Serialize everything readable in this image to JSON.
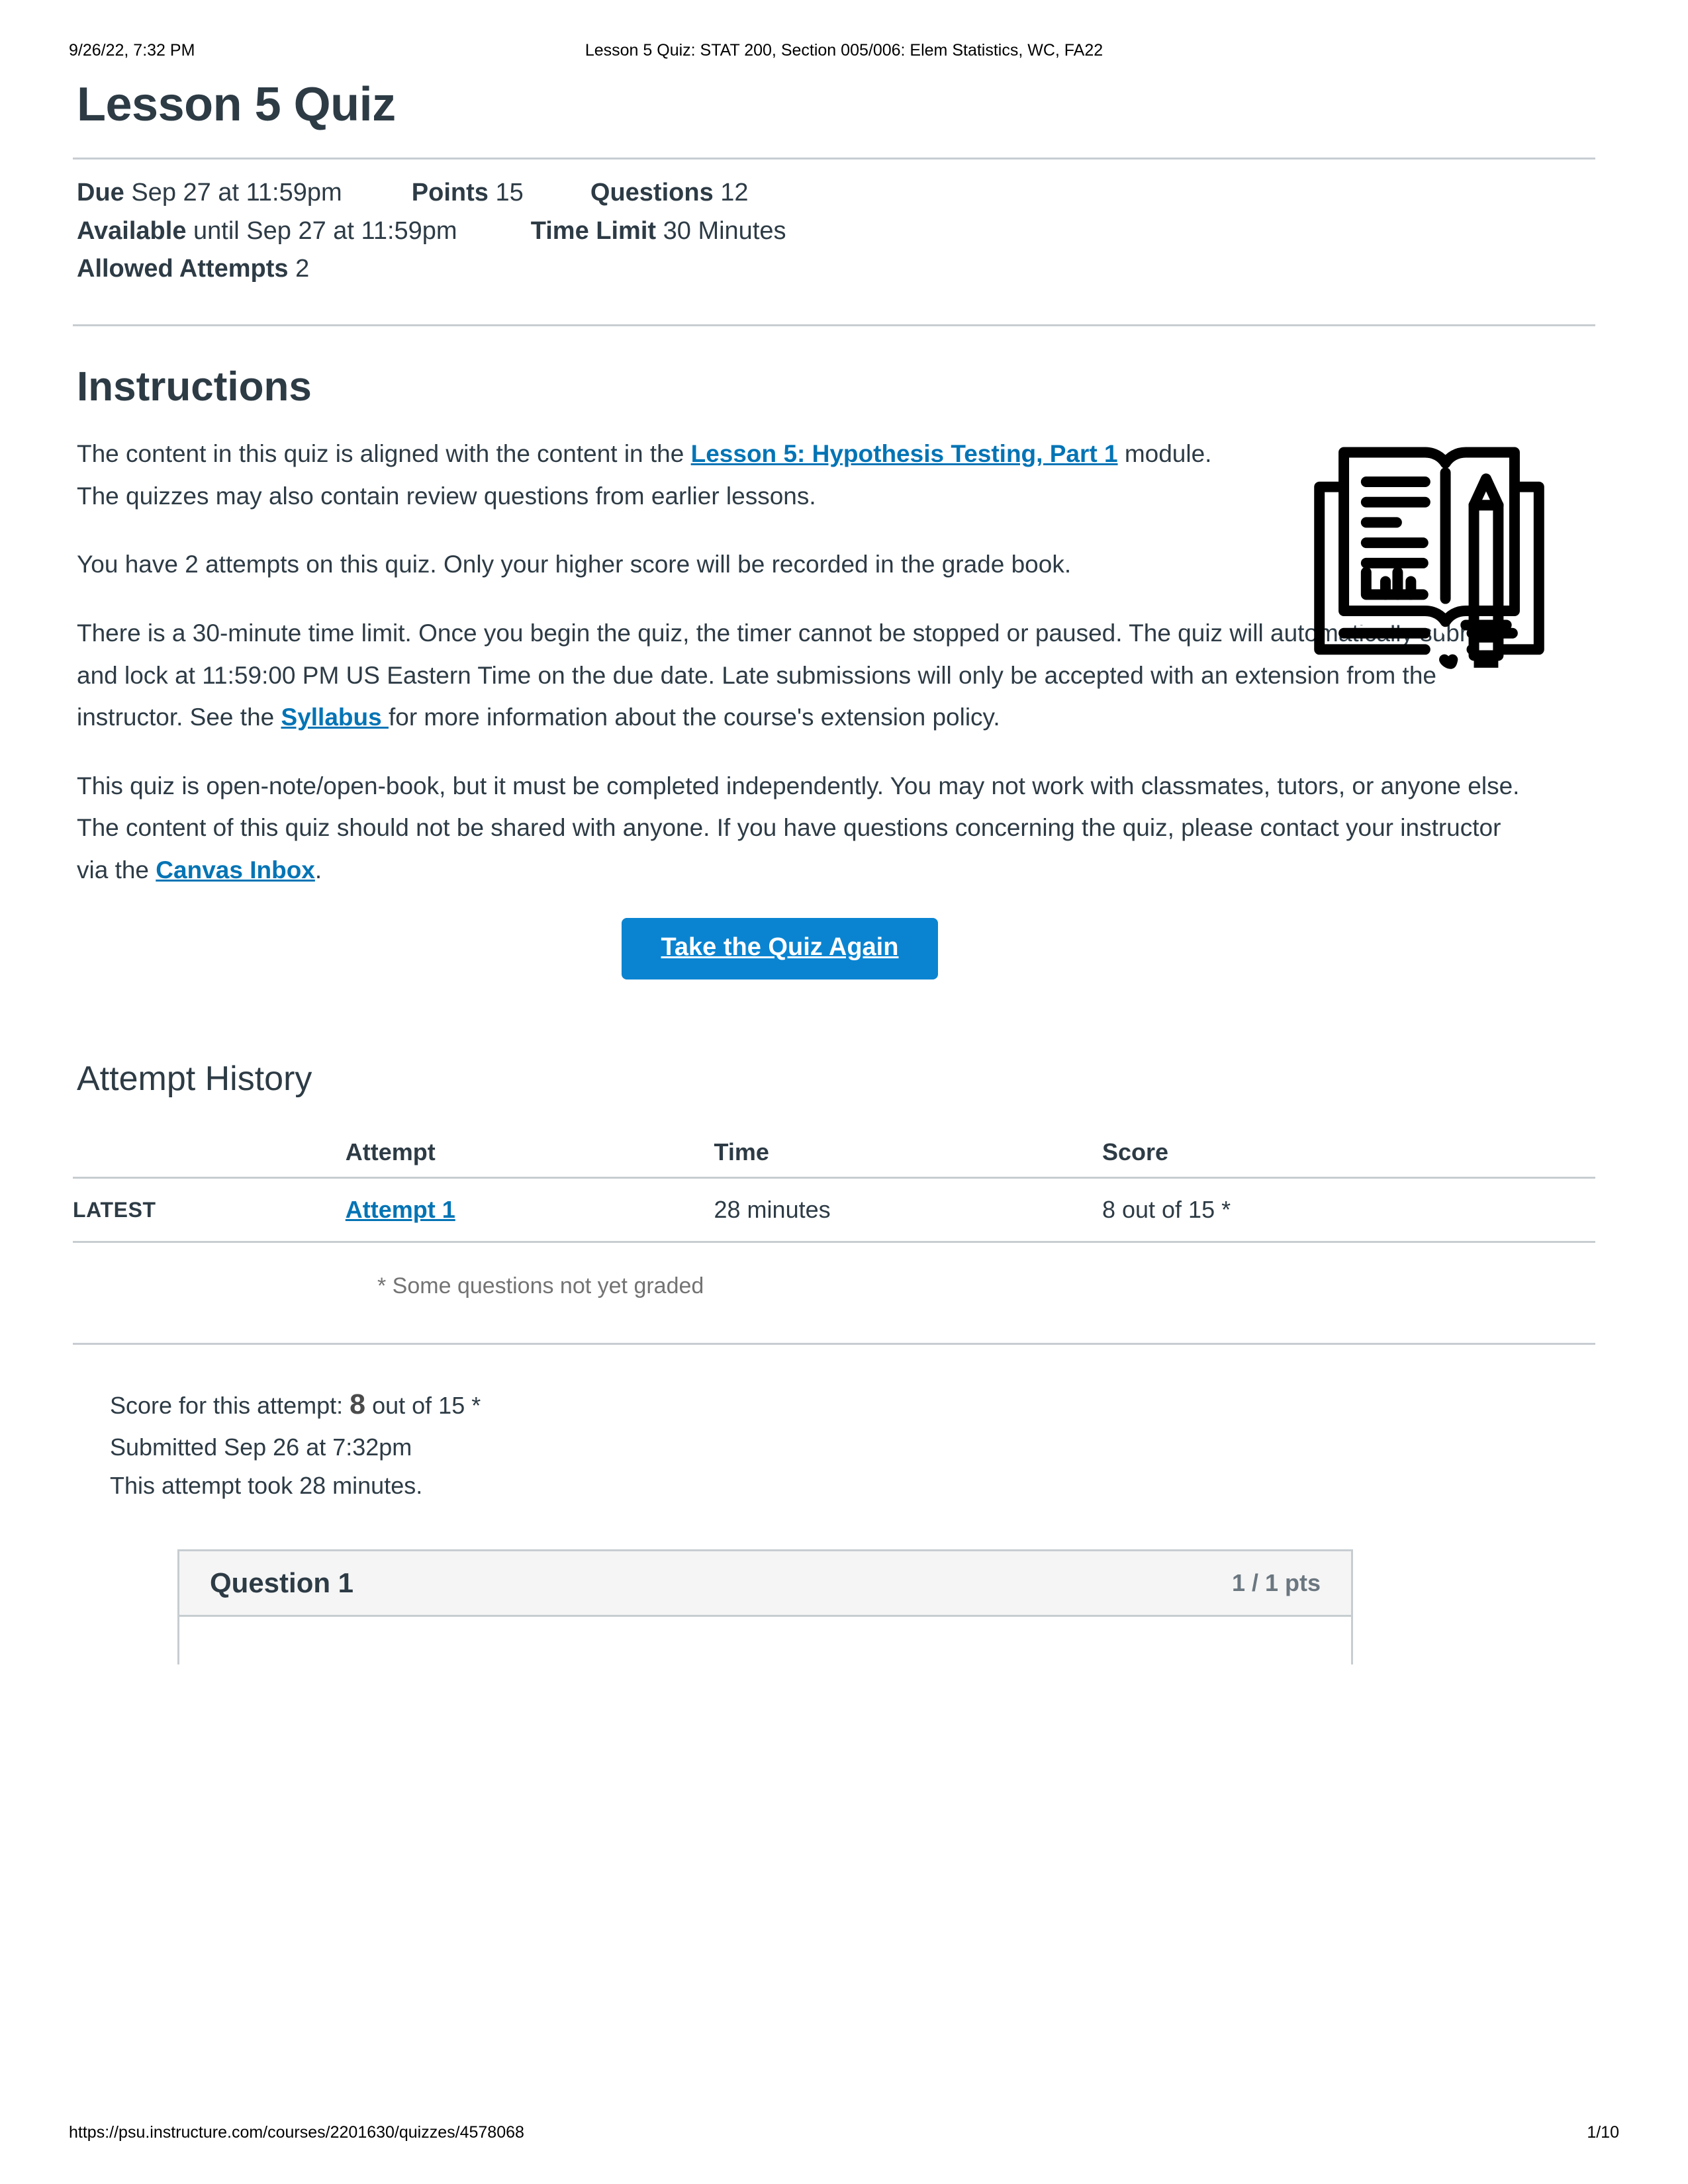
{
  "print": {
    "timestamp": "9/26/22, 7:32 PM",
    "doc_title": "Lesson 5 Quiz: STAT 200, Section 005/006: Elem Statistics, WC, FA22",
    "footer_url": "https://psu.instructure.com/courses/2201630/quizzes/4578068",
    "page_number": "1/10"
  },
  "quiz": {
    "title": "Lesson 5 Quiz",
    "meta": {
      "due_label": "Due",
      "due_value": "Sep 27 at 11:59pm",
      "points_label": "Points",
      "points_value": "15",
      "questions_label": "Questions",
      "questions_value": "12",
      "available_label": "Available",
      "available_value": "until Sep 27 at 11:59pm",
      "time_limit_label": "Time Limit",
      "time_limit_value": "30 Minutes",
      "allowed_attempts_label": "Allowed Attempts",
      "allowed_attempts_value": "2"
    }
  },
  "instructions": {
    "heading": "Instructions",
    "p1_before": "The content in this quiz is aligned with the content in the ",
    "p1_link": "Lesson 5: Hypothesis Testing, Part 1",
    "p1_after": " module. The quizzes may also contain review questions from earlier lessons.",
    "p2": "You have 2 attempts on this quiz. Only your higher score will be recorded in the grade book.",
    "p3_before": "There is a 30-minute time limit. Once you begin the quiz, the timer cannot be stopped or paused. The quiz will automatically submit and lock at 11:59:00 PM US Eastern Time on the due date. Late submissions will only be accepted with an extension from the instructor. See the ",
    "p3_link": "Syllabus ",
    "p3_after": "for more information about the course's extension policy.",
    "p4_before": "This quiz is open-note/open-book, but it must be completed independently. You may not work with classmates, tutors, or anyone else. The content of this quiz should not be shared with anyone. If you have questions concerning the quiz, please contact your instructor via the ",
    "p4_link": "Canvas Inbox",
    "p4_after": ".",
    "icon": "open-book-with-pencil-icon"
  },
  "actions": {
    "take_quiz_again": "Take the Quiz Again",
    "button_color": "#0a84d1"
  },
  "attempt_history": {
    "heading": "Attempt History",
    "columns": [
      "",
      "Attempt",
      "Time",
      "Score"
    ],
    "rows": [
      {
        "kept": "LATEST",
        "attempt": "Attempt 1 ",
        "time": "28 minutes",
        "score": "8 out of 15 *"
      }
    ],
    "note": "* Some questions not yet graded"
  },
  "attempt_summary": {
    "score_label": "Score for this attempt:",
    "score_value": "8",
    "score_suffix": " out of 15 *",
    "submitted": "Submitted Sep 26 at 7:32pm",
    "duration": "This attempt took 28 minutes."
  },
  "questions": [
    {
      "name": "Question 1",
      "points": "1 / 1 pts"
    }
  ],
  "colors": {
    "link": "#0374b5",
    "rule": "#c7cdd1",
    "muted": "#737373",
    "card_header_bg": "#f5f5f5"
  }
}
